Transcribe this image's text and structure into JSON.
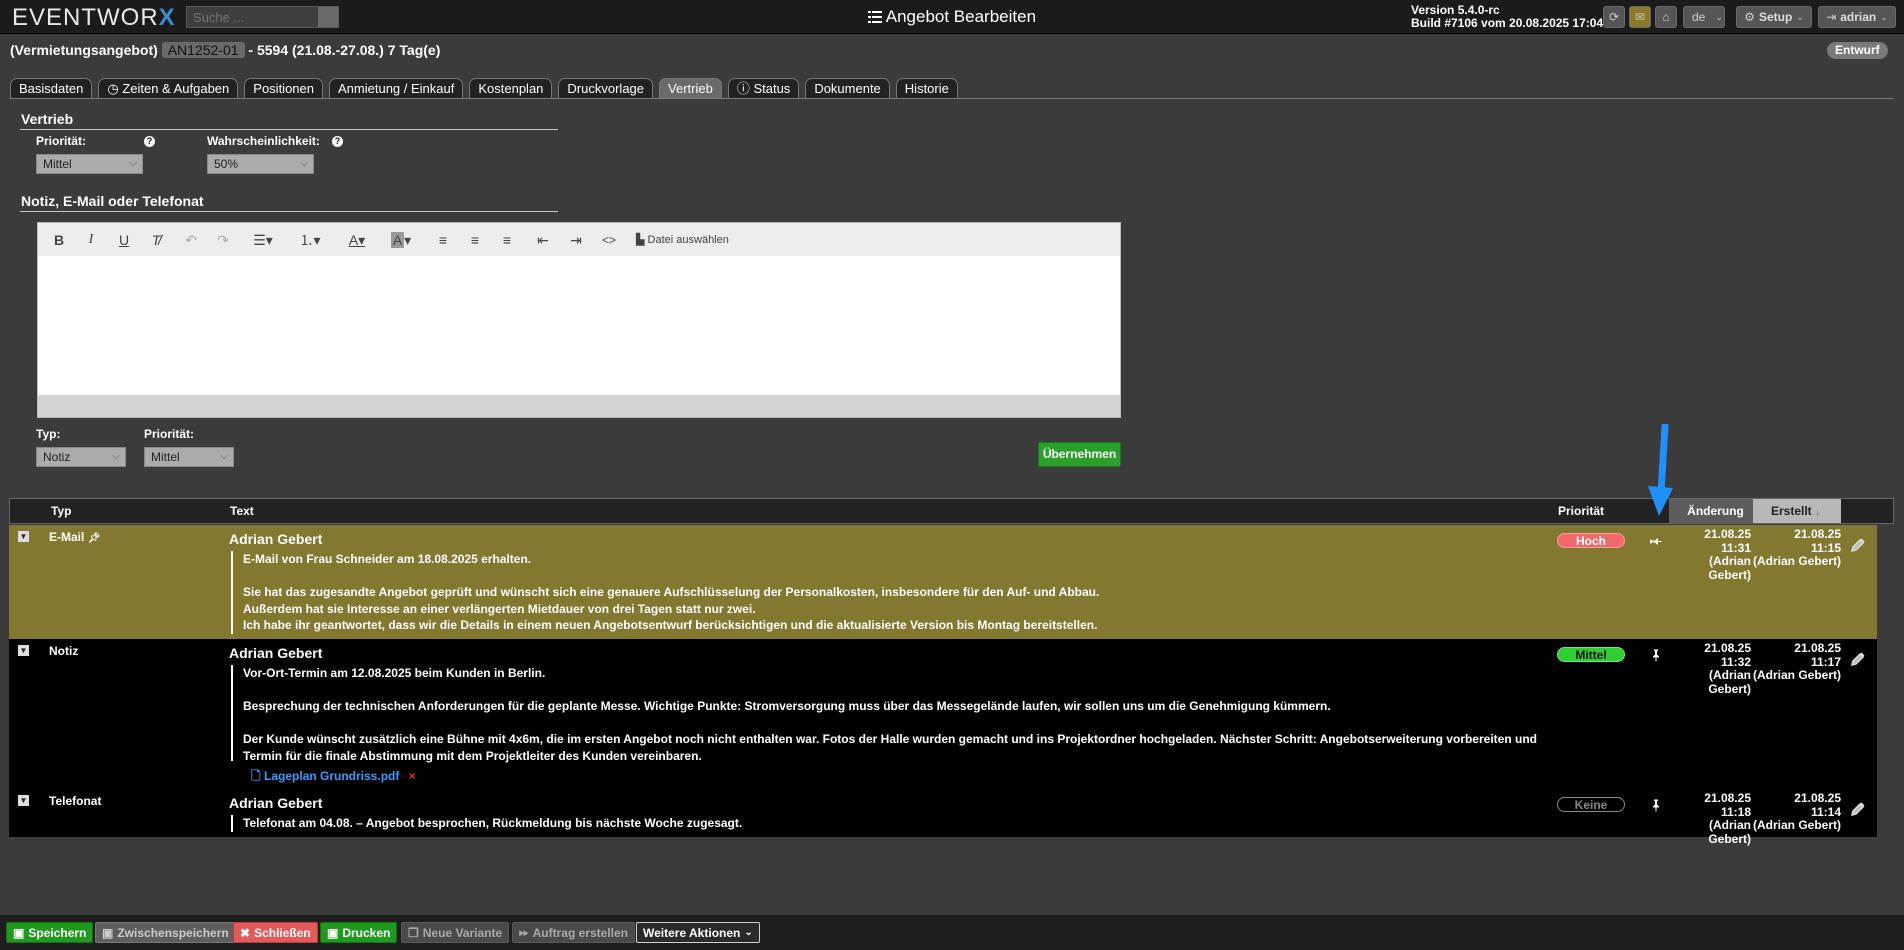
{
  "app": {
    "logo_text": "EVENTWOR",
    "logo_x": "X",
    "search_placeholder": "Suche ...",
    "page_title": "Angebot Bearbeiten",
    "version_line": "Version 5.4.0-rc",
    "build_line": "Build #7106 vom 20.08.2025 17:04",
    "language": "de",
    "setup_label": "Setup",
    "user_label": "adrian"
  },
  "header": {
    "doc_type": "(Vermietungsangebot)",
    "doc_number": "AN1252-01",
    "doc_rest": "- 5594 (21.08.-27.08.) 7 Tag(e)",
    "status": "Entwurf"
  },
  "tabs": [
    {
      "label": "Basisdaten"
    },
    {
      "label": "Zeiten & Aufgaben"
    },
    {
      "label": "Positionen"
    },
    {
      "label": "Anmietung / Einkauf"
    },
    {
      "label": "Kostenplan"
    },
    {
      "label": "Druckvorlage"
    },
    {
      "label": "Vertrieb"
    },
    {
      "label": "Status"
    },
    {
      "label": "Dokumente"
    },
    {
      "label": "Historie"
    }
  ],
  "vertrieb": {
    "title": "Vertrieb",
    "priority_label": "Priorität:",
    "priority_value": "Mittel",
    "probability_label": "Wahrscheinlichkeit:",
    "probability_value": "50%"
  },
  "note_form": {
    "title": "Notiz, E-Mail oder Telefonat",
    "file_button": "Datei auswählen",
    "type_label": "Typ:",
    "type_value": "Notiz",
    "priority_label": "Priorität:",
    "priority_value": "Mittel",
    "submit_label": "Übernehmen"
  },
  "table": {
    "columns": {
      "typ": "Typ",
      "text": "Text",
      "prioritaet": "Priorität",
      "aenderung": "Änderung",
      "erstellt": "Erstellt"
    },
    "rows": [
      {
        "type": "E-Mail",
        "author": "Adrian Gebert",
        "lines": [
          "E-Mail von Frau Schneider am 18.08.2025 erhalten.",
          "Sie hat das zugesandte Angebot geprüft und wünscht sich eine genauere Aufschlüsselung der Personalkosten, insbesondere für den Auf- und Abbau.",
          "Außerdem hat sie Interesse an einer verlängerten Mietdauer von drei Tagen statt nur zwei.",
          "Ich habe ihr geantwortet, dass wir die Details in einem neuen Angebotsentwurf berücksichtigen und die aktualisierte Version bis Montag bereitstellen."
        ],
        "priority": "Hoch",
        "changed": "21.08.25\n11:31\n(Adrian Gebert)",
        "created": "21.08.25\n11:15\n(Adrian Gebert)"
      },
      {
        "type": "Notiz",
        "author": "Adrian Gebert",
        "lines": [
          "Vor-Ort-Termin am 12.08.2025 beim Kunden in Berlin.",
          "Besprechung der technischen Anforderungen für die geplante Messe. Wichtige Punkte: Stromversorgung muss über das Messegelände laufen, wir sollen uns um die Genehmigung kümmern.",
          "Der Kunde wünscht zusätzlich eine Bühne mit 4x6m, die im ersten Angebot noch nicht enthalten war. Fotos der Halle wurden gemacht und ins Projektordner hochgeladen. Nächster Schritt: Angebotserweiterung vorbereiten und Termin für die finale Abstimmung mit dem Projektleiter des Kunden vereinbaren."
        ],
        "attachment": "Lageplan Grundriss.pdf",
        "attachment_delete": "×",
        "priority": "Mittel",
        "changed": "21.08.25\n11:32\n(Adrian Gebert)",
        "created": "21.08.25\n11:17\n(Adrian Gebert)"
      },
      {
        "type": "Telefonat",
        "author": "Adrian Gebert",
        "lines": [
          "Telefonat am 04.08. – Angebot besprochen, Rückmeldung bis nächste Woche zugesagt."
        ],
        "priority": "Keine",
        "changed": "21.08.25\n11:18\n(Adrian Gebert)",
        "created": "21.08.25\n11:14\n(Adrian Gebert)"
      }
    ]
  },
  "bottom": {
    "save": "Speichern",
    "intermediate_save": "Zwischenspeichern",
    "close": "Schließen",
    "print": "Drucken",
    "new_variant": "Neue Variante",
    "create_order": "Auftrag erstellen",
    "more_actions": "Weitere Aktionen"
  },
  "colors": {
    "accent_blue": "#3b8fd6",
    "email_row": "#827830",
    "priority_high": "#f06a6a",
    "priority_medium": "#2fd02f",
    "green_button": "#2aa02a"
  }
}
